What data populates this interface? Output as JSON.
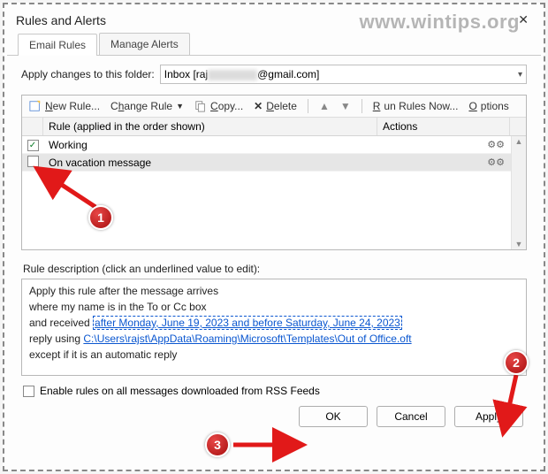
{
  "window": {
    "title": "Rules and Alerts",
    "watermark": "www.wintips.org"
  },
  "tabs": {
    "email_rules": "Email Rules",
    "manage_alerts": "Manage Alerts"
  },
  "folder": {
    "label": "Apply changes to this folder:",
    "prefix": "Inbox [raj",
    "suffix": "@gmail.com]"
  },
  "toolbar": {
    "new_rule": "New Rule...",
    "change_rule": "Change Rule",
    "copy": "Copy...",
    "delete": "Delete",
    "run_now": "Run Rules Now...",
    "options": "Options"
  },
  "grid": {
    "col_rule": "Rule (applied in the order shown)",
    "col_actions": "Actions",
    "rows": [
      {
        "checked": true,
        "name": "Working",
        "actions_icon": "⚙⚙",
        "selected": false
      },
      {
        "checked": false,
        "name": "On vacation message",
        "actions_icon": "⚙⚙",
        "selected": true
      }
    ]
  },
  "description": {
    "label": "Rule description (click an underlined value to edit):",
    "line1": "Apply this rule after the message arrives",
    "line2": "where my name is in the To or Cc box",
    "line3_prefix": "  and received ",
    "line3_link": "after Monday, June 19, 2023 and before Saturday, June 24, 2023",
    "line4_prefix": "reply using ",
    "line4_link": "C:\\Users\\rajst\\AppData\\Roaming\\Microsoft\\Templates\\Out of Office.oft",
    "line5": "except if it is an automatic reply"
  },
  "rss": {
    "label": "Enable rules on all messages downloaded from RSS Feeds"
  },
  "buttons": {
    "ok": "OK",
    "cancel": "Cancel",
    "apply": "Apply"
  },
  "annotations": {
    "b1": "1",
    "b2": "2",
    "b3": "3"
  }
}
